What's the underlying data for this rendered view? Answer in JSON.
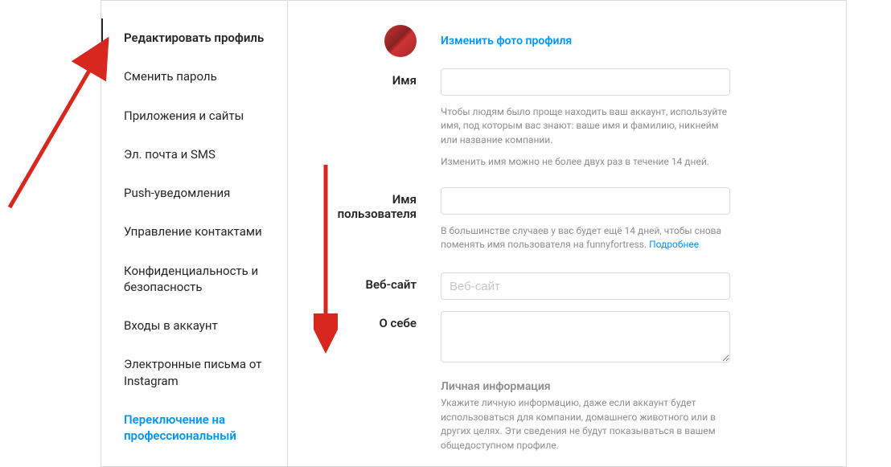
{
  "sidebar": {
    "items": [
      {
        "label": "Редактировать профиль",
        "active": true
      },
      {
        "label": "Сменить пароль"
      },
      {
        "label": "Приложения и сайты"
      },
      {
        "label": "Эл. почта и SMS"
      },
      {
        "label": "Push-уведомления"
      },
      {
        "label": "Управление контактами"
      },
      {
        "label": "Конфиденциальность и безопасность"
      },
      {
        "label": "Входы в аккаунт"
      },
      {
        "label": "Электронные письма от Instagram"
      },
      {
        "label": "Переключение на профессиональный",
        "link": true
      }
    ]
  },
  "form": {
    "change_photo": "Изменить фото профиля",
    "name_label": "Имя",
    "name_help1": "Чтобы людям было проще находить ваш аккаунт, используйте имя, под которым вас знают: ваше имя и фамилию, никнейм или название компании.",
    "name_help2": "Изменить имя можно не более двух раз в течение 14 дней.",
    "username_label": "Имя пользователя",
    "username_help_prefix": "В большинстве случаев у вас будет ещё 14 дней, чтобы снова поменять имя пользователя на funnyfortress. ",
    "username_help_link": "Подробнее",
    "website_label": "Веб-сайт",
    "website_placeholder": "Веб-сайт",
    "bio_label": "О себе",
    "personal_heading": "Личная информация",
    "personal_help": "Укажите личную информацию, даже если аккаунт будет использоваться для компании, домашнего животного или в других целях. Эти сведения не будут показываться в вашем общедоступном профиле."
  }
}
